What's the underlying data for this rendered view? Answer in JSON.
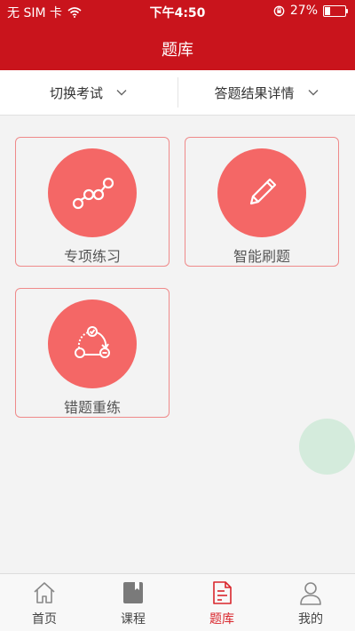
{
  "status_bar": {
    "carrier": "无 SIM 卡",
    "time": "下午4:50",
    "battery": "27%",
    "battery_level": 0.27
  },
  "header": {
    "title": "题库"
  },
  "filters": [
    {
      "label": "切换考试"
    },
    {
      "label": "答题结果详情"
    }
  ],
  "cards": [
    {
      "label": "专项练习",
      "icon": "connected-dots-icon"
    },
    {
      "label": "智能刷题",
      "icon": "pencil-icon"
    },
    {
      "label": "错题重练",
      "icon": "retry-cycle-icon"
    }
  ],
  "tabs": [
    {
      "label": "首页",
      "icon": "home-icon"
    },
    {
      "label": "课程",
      "icon": "book-icon"
    },
    {
      "label": "题库",
      "icon": "document-icon",
      "active": true
    },
    {
      "label": "我的",
      "icon": "user-icon"
    }
  ],
  "colors": {
    "brand": "#c9141c",
    "circle": "#f46766",
    "card_border": "#ef8a8a",
    "tab_active": "#d9262c",
    "float_button": "#d4ebdc"
  }
}
